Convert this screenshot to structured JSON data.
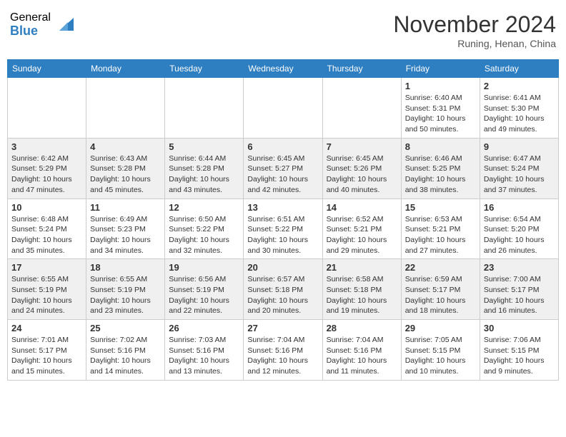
{
  "header": {
    "logo_general": "General",
    "logo_blue": "Blue",
    "month": "November 2024",
    "location": "Runing, Henan, China"
  },
  "weekdays": [
    "Sunday",
    "Monday",
    "Tuesday",
    "Wednesday",
    "Thursday",
    "Friday",
    "Saturday"
  ],
  "weeks": [
    [
      {
        "day": "",
        "info": ""
      },
      {
        "day": "",
        "info": ""
      },
      {
        "day": "",
        "info": ""
      },
      {
        "day": "",
        "info": ""
      },
      {
        "day": "",
        "info": ""
      },
      {
        "day": "1",
        "info": "Sunrise: 6:40 AM\nSunset: 5:31 PM\nDaylight: 10 hours\nand 50 minutes."
      },
      {
        "day": "2",
        "info": "Sunrise: 6:41 AM\nSunset: 5:30 PM\nDaylight: 10 hours\nand 49 minutes."
      }
    ],
    [
      {
        "day": "3",
        "info": "Sunrise: 6:42 AM\nSunset: 5:29 PM\nDaylight: 10 hours\nand 47 minutes."
      },
      {
        "day": "4",
        "info": "Sunrise: 6:43 AM\nSunset: 5:28 PM\nDaylight: 10 hours\nand 45 minutes."
      },
      {
        "day": "5",
        "info": "Sunrise: 6:44 AM\nSunset: 5:28 PM\nDaylight: 10 hours\nand 43 minutes."
      },
      {
        "day": "6",
        "info": "Sunrise: 6:45 AM\nSunset: 5:27 PM\nDaylight: 10 hours\nand 42 minutes."
      },
      {
        "day": "7",
        "info": "Sunrise: 6:45 AM\nSunset: 5:26 PM\nDaylight: 10 hours\nand 40 minutes."
      },
      {
        "day": "8",
        "info": "Sunrise: 6:46 AM\nSunset: 5:25 PM\nDaylight: 10 hours\nand 38 minutes."
      },
      {
        "day": "9",
        "info": "Sunrise: 6:47 AM\nSunset: 5:24 PM\nDaylight: 10 hours\nand 37 minutes."
      }
    ],
    [
      {
        "day": "10",
        "info": "Sunrise: 6:48 AM\nSunset: 5:24 PM\nDaylight: 10 hours\nand 35 minutes."
      },
      {
        "day": "11",
        "info": "Sunrise: 6:49 AM\nSunset: 5:23 PM\nDaylight: 10 hours\nand 34 minutes."
      },
      {
        "day": "12",
        "info": "Sunrise: 6:50 AM\nSunset: 5:22 PM\nDaylight: 10 hours\nand 32 minutes."
      },
      {
        "day": "13",
        "info": "Sunrise: 6:51 AM\nSunset: 5:22 PM\nDaylight: 10 hours\nand 30 minutes."
      },
      {
        "day": "14",
        "info": "Sunrise: 6:52 AM\nSunset: 5:21 PM\nDaylight: 10 hours\nand 29 minutes."
      },
      {
        "day": "15",
        "info": "Sunrise: 6:53 AM\nSunset: 5:21 PM\nDaylight: 10 hours\nand 27 minutes."
      },
      {
        "day": "16",
        "info": "Sunrise: 6:54 AM\nSunset: 5:20 PM\nDaylight: 10 hours\nand 26 minutes."
      }
    ],
    [
      {
        "day": "17",
        "info": "Sunrise: 6:55 AM\nSunset: 5:19 PM\nDaylight: 10 hours\nand 24 minutes."
      },
      {
        "day": "18",
        "info": "Sunrise: 6:55 AM\nSunset: 5:19 PM\nDaylight: 10 hours\nand 23 minutes."
      },
      {
        "day": "19",
        "info": "Sunrise: 6:56 AM\nSunset: 5:19 PM\nDaylight: 10 hours\nand 22 minutes."
      },
      {
        "day": "20",
        "info": "Sunrise: 6:57 AM\nSunset: 5:18 PM\nDaylight: 10 hours\nand 20 minutes."
      },
      {
        "day": "21",
        "info": "Sunrise: 6:58 AM\nSunset: 5:18 PM\nDaylight: 10 hours\nand 19 minutes."
      },
      {
        "day": "22",
        "info": "Sunrise: 6:59 AM\nSunset: 5:17 PM\nDaylight: 10 hours\nand 18 minutes."
      },
      {
        "day": "23",
        "info": "Sunrise: 7:00 AM\nSunset: 5:17 PM\nDaylight: 10 hours\nand 16 minutes."
      }
    ],
    [
      {
        "day": "24",
        "info": "Sunrise: 7:01 AM\nSunset: 5:17 PM\nDaylight: 10 hours\nand 15 minutes."
      },
      {
        "day": "25",
        "info": "Sunrise: 7:02 AM\nSunset: 5:16 PM\nDaylight: 10 hours\nand 14 minutes."
      },
      {
        "day": "26",
        "info": "Sunrise: 7:03 AM\nSunset: 5:16 PM\nDaylight: 10 hours\nand 13 minutes."
      },
      {
        "day": "27",
        "info": "Sunrise: 7:04 AM\nSunset: 5:16 PM\nDaylight: 10 hours\nand 12 minutes."
      },
      {
        "day": "28",
        "info": "Sunrise: 7:04 AM\nSunset: 5:16 PM\nDaylight: 10 hours\nand 11 minutes."
      },
      {
        "day": "29",
        "info": "Sunrise: 7:05 AM\nSunset: 5:15 PM\nDaylight: 10 hours\nand 10 minutes."
      },
      {
        "day": "30",
        "info": "Sunrise: 7:06 AM\nSunset: 5:15 PM\nDaylight: 10 hours\nand 9 minutes."
      }
    ]
  ]
}
